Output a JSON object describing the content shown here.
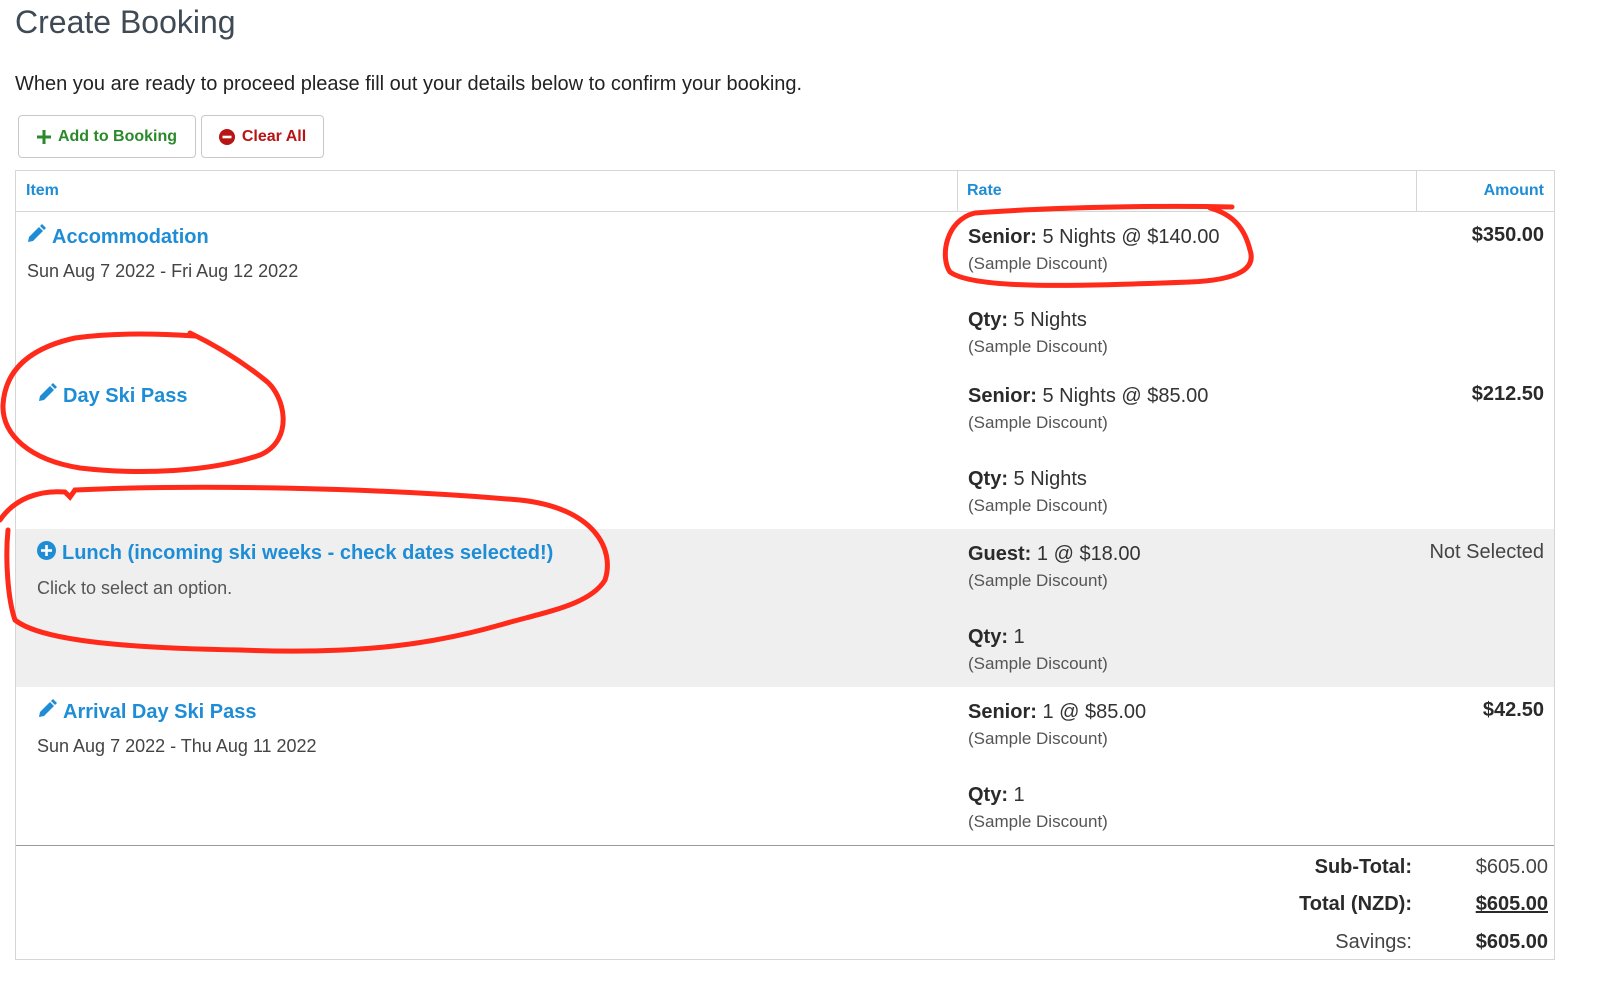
{
  "page": {
    "title": "Create Booking",
    "intro": "When you are ready to proceed please fill out your details below to confirm your booking."
  },
  "toolbar": {
    "add_label": "Add to Booking",
    "clear_label": "Clear All"
  },
  "table": {
    "headers": {
      "item": "Item",
      "rate": "Rate",
      "amount": "Amount"
    },
    "rows": [
      {
        "title": "Accommodation",
        "subtitle": "Sun Aug 7 2022 - Fri Aug 12 2022",
        "icon": "pencil-icon",
        "rate": {
          "label": "Senior:",
          "text": " 5 Nights @ $140.00",
          "note": "(Sample Discount)"
        },
        "qty": {
          "label": "Qty:",
          "text": " 5 Nights",
          "note": "(Sample Discount)"
        },
        "amount": "$350.00"
      },
      {
        "title": "Day Ski Pass",
        "subtitle": "",
        "icon": "pencil-icon",
        "rate": {
          "label": "Senior:",
          "text": " 5 Nights @ $85.00",
          "note": "(Sample Discount)"
        },
        "qty": {
          "label": "Qty:",
          "text": " 5 Nights",
          "note": "(Sample Discount)"
        },
        "amount": "$212.50"
      },
      {
        "title": "Lunch (incoming ski weeks - check dates selected!)",
        "subtitle": "Click to select an option.",
        "icon": "plus-circle-icon",
        "rate": {
          "label": "Guest:",
          "text": " 1 @ $18.00",
          "note": "(Sample Discount)"
        },
        "qty": {
          "label": "Qty:",
          "text": " 1",
          "note": "(Sample Discount)"
        },
        "amount": "Not Selected"
      },
      {
        "title": "Arrival Day Ski Pass",
        "subtitle": "Sun Aug 7 2022 - Thu Aug 11 2022",
        "icon": "pencil-icon",
        "rate": {
          "label": "Senior:",
          "text": " 1 @ $85.00",
          "note": "(Sample Discount)"
        },
        "qty": {
          "label": "Qty:",
          "text": " 1",
          "note": "(Sample Discount)"
        },
        "amount": "$42.50"
      }
    ]
  },
  "totals": {
    "subtotal_label": "Sub-Total:",
    "subtotal": "$605.00",
    "total_label": "Total (NZD):",
    "total": "$605.00",
    "savings_label": "Savings:",
    "savings": "$605.00"
  },
  "colors": {
    "link": "#1e8dd6",
    "add": "#2a8a2a",
    "clear": "#b81414",
    "annotation": "#ff2a1a",
    "shaded_row": "#efefef"
  }
}
